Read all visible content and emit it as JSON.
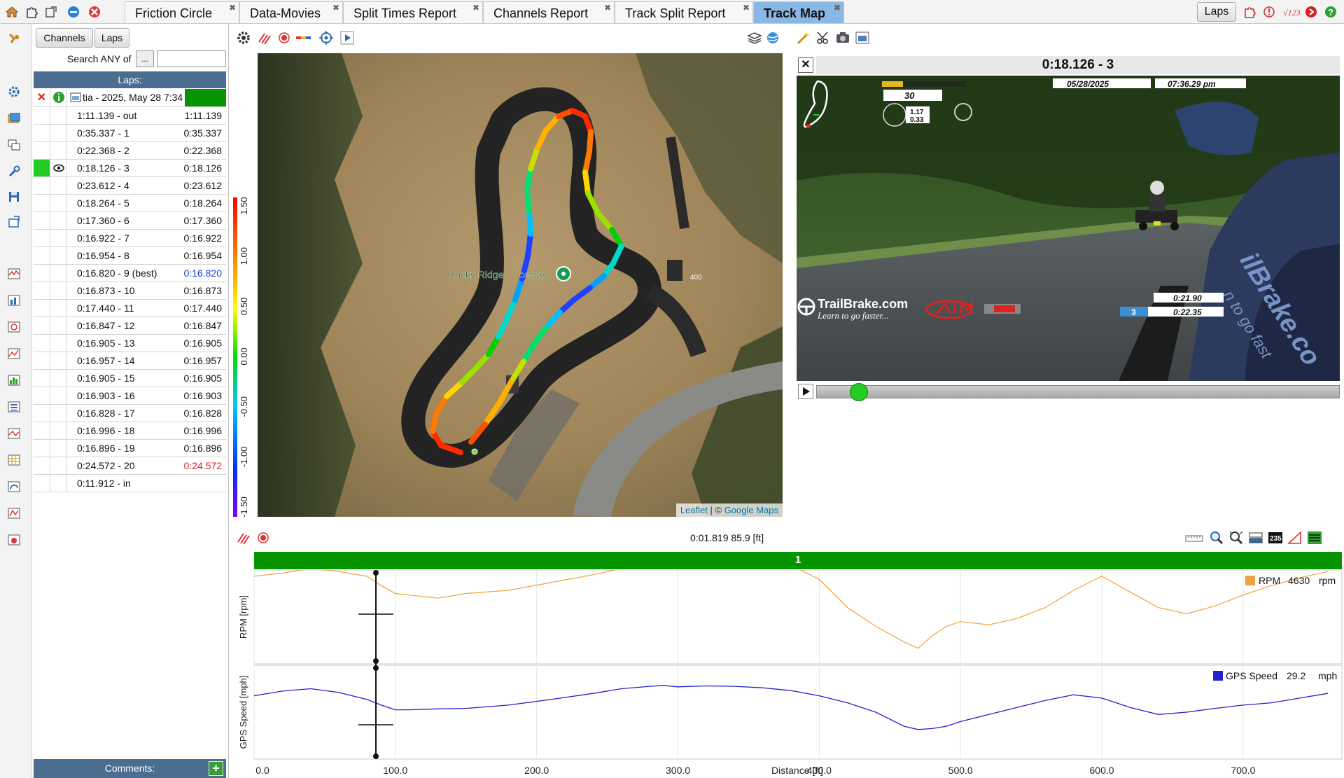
{
  "tabs": [
    {
      "label": "Friction Circle",
      "active": false
    },
    {
      "label": "Data-Movies",
      "active": false
    },
    {
      "label": "Split Times Report",
      "active": false
    },
    {
      "label": "Channels Report",
      "active": false
    },
    {
      "label": "Track Split Report",
      "active": false
    },
    {
      "label": "Track Map",
      "active": true
    }
  ],
  "top_right": {
    "laps_button": "Laps"
  },
  "laps_panel": {
    "channels_button": "Channels",
    "laps_button": "Laps",
    "search_label": "Search ANY of",
    "search_button": "...",
    "search_value": "",
    "header": "Laps:",
    "session_label": "tia - 2025, May 28 7:34",
    "comments_label": "Comments:",
    "comments_add": "+",
    "laps": [
      {
        "name": "1:11.139 - out",
        "time": "1:11.139",
        "color": "#111111"
      },
      {
        "name": "0:35.337 - 1",
        "time": "0:35.337",
        "color": "#111111"
      },
      {
        "name": "0:22.368 - 2",
        "time": "0:22.368",
        "color": "#111111"
      },
      {
        "name": "0:18.126 - 3",
        "time": "0:18.126",
        "color": "#111111",
        "selected": true
      },
      {
        "name": "0:23.612 - 4",
        "time": "0:23.612",
        "color": "#111111"
      },
      {
        "name": "0:18.264 - 5",
        "time": "0:18.264",
        "color": "#111111"
      },
      {
        "name": "0:17.360 - 6",
        "time": "0:17.360",
        "color": "#111111"
      },
      {
        "name": "0:16.922 - 7",
        "time": "0:16.922",
        "color": "#111111"
      },
      {
        "name": "0:16.954 - 8",
        "time": "0:16.954",
        "color": "#111111"
      },
      {
        "name": "0:16.820 - 9 (best)",
        "time": "0:16.820",
        "color": "#1f3fd6"
      },
      {
        "name": "0:16.873 - 10",
        "time": "0:16.873",
        "color": "#111111"
      },
      {
        "name": "0:17.440 - 11",
        "time": "0:17.440",
        "color": "#111111"
      },
      {
        "name": "0:16.847 - 12",
        "time": "0:16.847",
        "color": "#111111"
      },
      {
        "name": "0:16.905 - 13",
        "time": "0:16.905",
        "color": "#111111"
      },
      {
        "name": "0:16.957 - 14",
        "time": "0:16.957",
        "color": "#111111"
      },
      {
        "name": "0:16.905 - 15",
        "time": "0:16.905",
        "color": "#111111"
      },
      {
        "name": "0:16.903 - 16",
        "time": "0:16.903",
        "color": "#111111"
      },
      {
        "name": "0:16.828 - 17",
        "time": "0:16.828",
        "color": "#111111"
      },
      {
        "name": "0:16.996 - 18",
        "time": "0:16.996",
        "color": "#111111"
      },
      {
        "name": "0:16.896 - 19",
        "time": "0:16.896",
        "color": "#111111"
      },
      {
        "name": "0:24.572 - 20",
        "time": "0:24.572",
        "color": "#e02020"
      },
      {
        "name": "0:11.912 - in",
        "time": "",
        "color": "#111111"
      }
    ]
  },
  "map": {
    "legend_ticks": [
      "1.50",
      "1.00",
      "0.50",
      "0.00",
      "-0.50",
      "-1.00",
      "-1.50"
    ],
    "place_label": "Rocky Ridge",
    "place_label_tail": "ceway",
    "marker_label": "400",
    "attribution_leaflet": "Leaflet",
    "attribution_sep": " | © ",
    "attribution_google": "Google Maps"
  },
  "video": {
    "title": "0:18.126 - 3",
    "overlay_date": "05/28/2025",
    "overlay_time": "07:36.29  pm",
    "overlay_speed": "30",
    "overlay_g1": "1.17",
    "overlay_g2": "0.33",
    "overlay_lap_time_1": "0:21.90",
    "overlay_lap_no": "3",
    "overlay_lap_time_2": "0:22.35",
    "brand": "TrailBrake.com",
    "brand_tagline": "Learn to go faster...",
    "suit_text": "ilBrake.co",
    "suit_text2": "n to go fast",
    "progress_fraction": 0.05
  },
  "bottom": {
    "cursor_readout": "0:01.819 85.9 [ft]",
    "lap_number": "1",
    "counter_badge": "235",
    "rpm_channel": "RPM",
    "rpm_value": "4630",
    "rpm_unit": "rpm",
    "rpm_axis_label": "RPM [rpm]",
    "speed_channel": "GPS Speed",
    "speed_value": "29.2",
    "speed_unit": "mph",
    "speed_axis_label": "GPS Speed [mph]",
    "x_axis_label": "Distance [ft]",
    "x_ticks": [
      "0.0",
      "100.0",
      "200.0",
      "300.0",
      "400.0",
      "500.0",
      "600.0",
      "700.0"
    ]
  },
  "colors": {
    "tab_active": "#8ab8e6",
    "panel_header": "#4a6d90",
    "lap_strip": "#069400",
    "rpm_trace": "#f0a040",
    "speed_trace": "#2222cc",
    "best_lap": "#1f3fd6",
    "slow_lap": "#e02020"
  },
  "chart_data": [
    {
      "type": "line",
      "title": "",
      "xlabel": "Distance [ft]",
      "ylabel": "RPM [rpm]",
      "xlim": [
        0,
        760
      ],
      "ylim": [
        3000,
        6000
      ],
      "series": [
        {
          "name": "RPM",
          "x": [
            0,
            20,
            40,
            60,
            80,
            90,
            100,
            110,
            130,
            150,
            180,
            210,
            240,
            260,
            280,
            290,
            300,
            320,
            340,
            360,
            380,
            400,
            420,
            440,
            460,
            470,
            480,
            490,
            500,
            520,
            540,
            560,
            580,
            600,
            620,
            640,
            660,
            680,
            700,
            720,
            740,
            760
          ],
          "values": [
            5800,
            5900,
            6050,
            5950,
            5800,
            5500,
            5250,
            5200,
            5100,
            5250,
            5350,
            5600,
            5850,
            6050,
            6250,
            6350,
            6250,
            6100,
            6200,
            6300,
            6150,
            5700,
            4800,
            4200,
            3700,
            3500,
            3900,
            4200,
            4350,
            4250,
            4450,
            4800,
            5350,
            5800,
            5300,
            4800,
            4600,
            4850,
            5200,
            5500,
            5750,
            5950
          ]
        }
      ]
    },
    {
      "type": "line",
      "title": "",
      "xlabel": "Distance [ft]",
      "ylabel": "GPS Speed [mph]",
      "xlim": [
        0,
        760
      ],
      "ylim": [
        16,
        36
      ],
      "series": [
        {
          "name": "GPS Speed",
          "x": [
            0,
            20,
            40,
            60,
            80,
            90,
            100,
            110,
            130,
            150,
            180,
            210,
            240,
            260,
            280,
            290,
            300,
            320,
            340,
            360,
            380,
            400,
            420,
            440,
            460,
            470,
            480,
            490,
            500,
            520,
            540,
            560,
            580,
            600,
            620,
            640,
            660,
            680,
            700,
            720,
            740,
            760
          ],
          "values": [
            29.5,
            30.5,
            31.0,
            30.2,
            28.7,
            27.5,
            26.5,
            26.5,
            26.7,
            26.8,
            27.5,
            28.7,
            30.0,
            31.0,
            31.5,
            31.7,
            31.4,
            31.6,
            31.5,
            31.2,
            30.6,
            29.5,
            28.0,
            26.0,
            23.0,
            22.3,
            22.5,
            23.0,
            24.0,
            25.5,
            27.0,
            28.5,
            29.7,
            29.0,
            27.0,
            25.5,
            26.0,
            26.8,
            27.5,
            28.0,
            29.0,
            30.0
          ]
        }
      ]
    }
  ]
}
